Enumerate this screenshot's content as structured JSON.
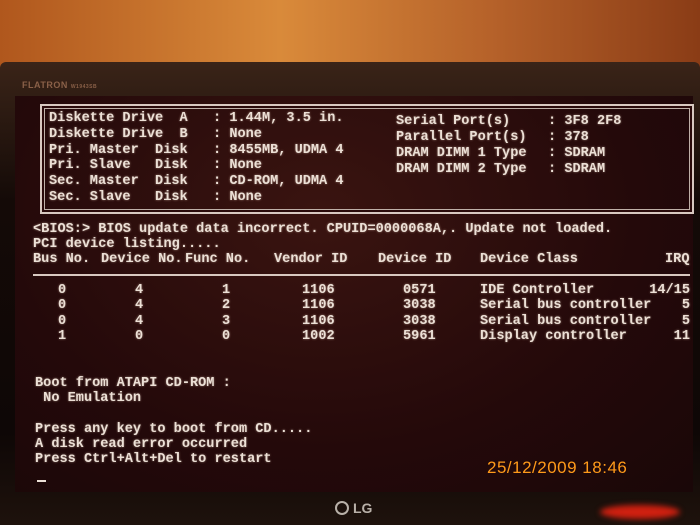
{
  "monitor": {
    "brand": "FLATRON",
    "model": "W1943SB",
    "logo": "LG"
  },
  "config": {
    "left": [
      {
        "label": "Diskette Drive  A",
        "value": "1.44M, 3.5 in."
      },
      {
        "label": "Diskette Drive  B",
        "value": "None"
      },
      {
        "label": "Pri. Master  Disk",
        "value": "8455MB, UDMA 4"
      },
      {
        "label": "Pri. Slave   Disk",
        "value": "None"
      },
      {
        "label": "Sec. Master  Disk",
        "value": "CD-ROM, UDMA 4"
      },
      {
        "label": "Sec. Slave   Disk",
        "value": "None"
      }
    ],
    "right": [
      {
        "label": "Serial Port(s)",
        "value": "3F8 2F8"
      },
      {
        "label": "Parallel Port(s)",
        "value": "378"
      },
      {
        "label": "DRAM DIMM 1 Type",
        "value": "SDRAM"
      },
      {
        "label": "DRAM DIMM 2 Type",
        "value": "SDRAM"
      }
    ]
  },
  "messages": {
    "bios": "<BIOS:> BIOS update data incorrect. CPUID=0000068A,. Update not loaded.",
    "pci": "PCI device listing....."
  },
  "pci_table": {
    "headers": [
      "Bus No.",
      "Device No.",
      "Func No.",
      "Vendor ID",
      "Device ID",
      "Device Class",
      "IRQ"
    ],
    "rows": [
      [
        "0",
        "4",
        "1",
        "1106",
        "0571",
        "IDE Controller",
        "14/15"
      ],
      [
        "0",
        "4",
        "2",
        "1106",
        "3038",
        "Serial bus controller",
        "5"
      ],
      [
        "0",
        "4",
        "3",
        "1106",
        "3038",
        "Serial bus controller",
        "5"
      ],
      [
        "1",
        "0",
        "0",
        "1002",
        "5961",
        "Display controller",
        "11"
      ]
    ]
  },
  "boot": [
    "Boot from ATAPI CD-ROM :",
    " No Emulation",
    "Press any key to boot from CD.....",
    "A disk read error occurred",
    "Press Ctrl+Alt+Del to restart"
  ],
  "timestamp": "25/12/2009  18:46",
  "colors": {
    "screen": "#24090a",
    "text": "#ece0d6",
    "timestamp": "#ff9a1a"
  }
}
